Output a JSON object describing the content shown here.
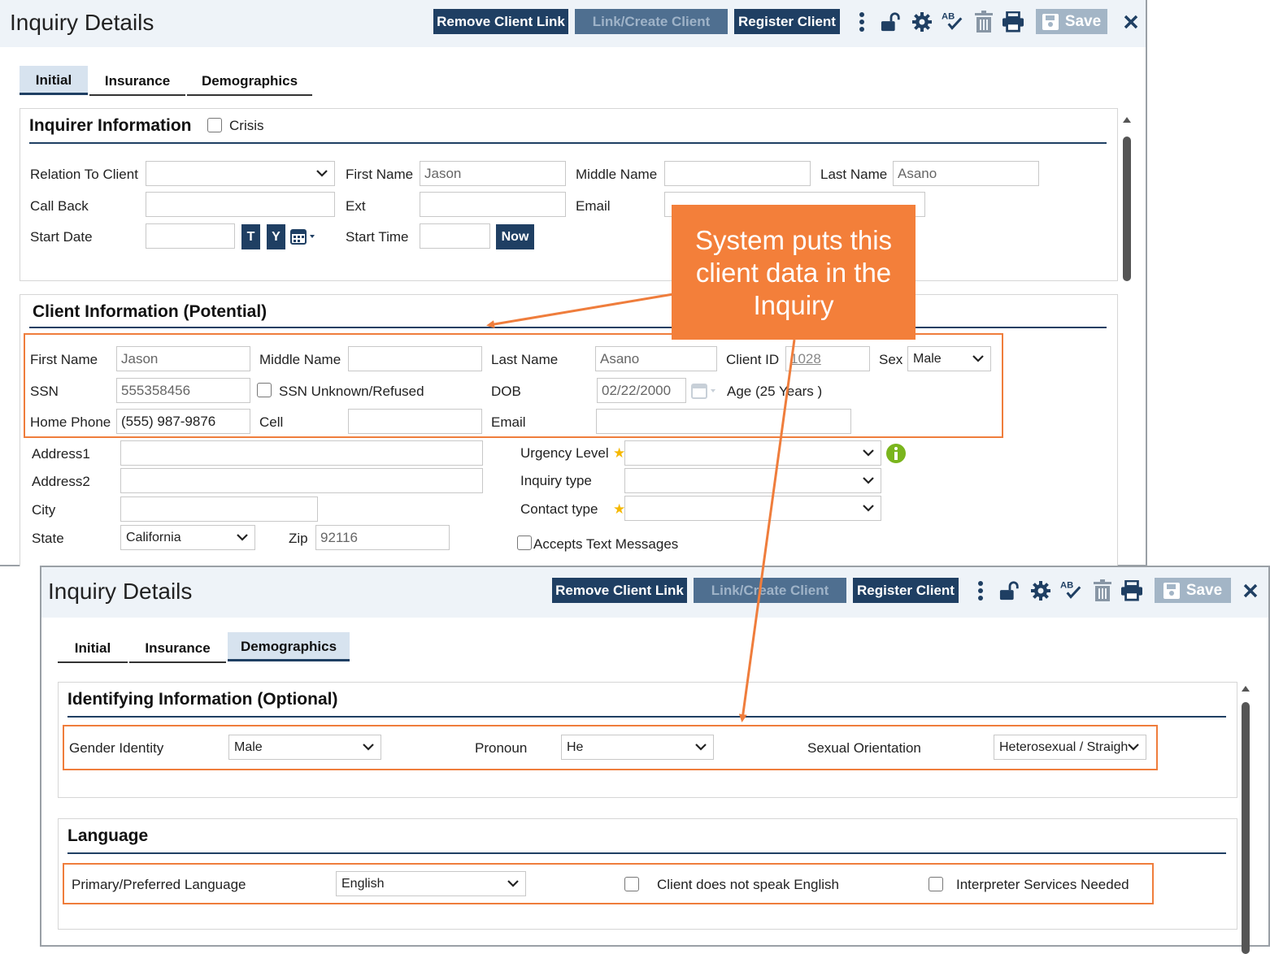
{
  "window1": {
    "title": "Inquiry Details",
    "toolbar": {
      "remove_client_link": "Remove Client Link",
      "link_create_client": "Link/Create Client",
      "register_client": "Register Client",
      "save": "Save"
    },
    "tabs": [
      {
        "label": "Initial",
        "active": true
      },
      {
        "label": "Insurance",
        "active": false
      },
      {
        "label": "Demographics",
        "active": false
      }
    ],
    "inquirer": {
      "heading": "Inquirer Information",
      "crisis_label": "Crisis",
      "relation_label": "Relation To Client",
      "relation_value": "",
      "first_name_label": "First Name",
      "first_name_value": "Jason",
      "middle_name_label": "Middle Name",
      "middle_name_value": "",
      "last_name_label": "Last Name",
      "last_name_value": "Asano",
      "call_back_label": "Call Back",
      "ext_label": "Ext",
      "email_label": "Email",
      "start_date_label": "Start Date",
      "today_btn": "T",
      "yesterday_btn": "Y",
      "start_time_label": "Start Time",
      "now_btn": "Now"
    },
    "client": {
      "heading": "Client Information (Potential)",
      "first_name_label": "First Name",
      "first_name_value": "Jason",
      "middle_name_label": "Middle Name",
      "last_name_label": "Last Name",
      "last_name_value": "Asano",
      "client_id_label": "Client ID",
      "client_id_value": "1028",
      "sex_label": "Sex",
      "sex_value": "Male",
      "ssn_label": "SSN",
      "ssn_value": "555358456",
      "ssn_unknown_label": "SSN Unknown/Refused",
      "dob_label": "DOB",
      "dob_value": "02/22/2000",
      "age_text": "Age (25 Years )",
      "home_phone_label": "Home Phone",
      "home_phone_value": "(555) 987-9876",
      "cell_label": "Cell",
      "email_label": "Email",
      "address1_label": "Address1",
      "address2_label": "Address2",
      "city_label": "City",
      "state_label": "State",
      "state_value": "California",
      "zip_label": "Zip",
      "zip_value": "92116",
      "urgency_label": "Urgency Level",
      "inquiry_type_label": "Inquiry type",
      "contact_type_label": "Contact type",
      "accepts_text_label": "Accepts Text Messages"
    }
  },
  "callout": {
    "text": "System puts this client data in the Inquiry"
  },
  "window2": {
    "title": "Inquiry Details",
    "toolbar": {
      "remove_client_link": "Remove Client Link",
      "link_create_client": "Link/Create Client",
      "register_client": "Register Client",
      "save": "Save"
    },
    "tabs": [
      {
        "label": "Initial",
        "active": false
      },
      {
        "label": "Insurance",
        "active": false
      },
      {
        "label": "Demographics",
        "active": true
      }
    ],
    "identifying": {
      "heading": "Identifying Information (Optional)",
      "gender_identity_label": "Gender Identity",
      "gender_identity_value": "Male",
      "pronoun_label": "Pronoun",
      "pronoun_value": "He",
      "sexual_orientation_label": "Sexual Orientation",
      "sexual_orientation_value": "Heterosexual / Straight"
    },
    "language": {
      "heading": "Language",
      "primary_label": "Primary/Preferred Language",
      "primary_value": "English",
      "no_english_label": "Client does not speak English",
      "interpreter_label": "Interpreter Services Needed"
    }
  },
  "colors": {
    "primary": "#1f3f63",
    "highlight": "#ef7d3c",
    "callout": "#f37f3a"
  }
}
